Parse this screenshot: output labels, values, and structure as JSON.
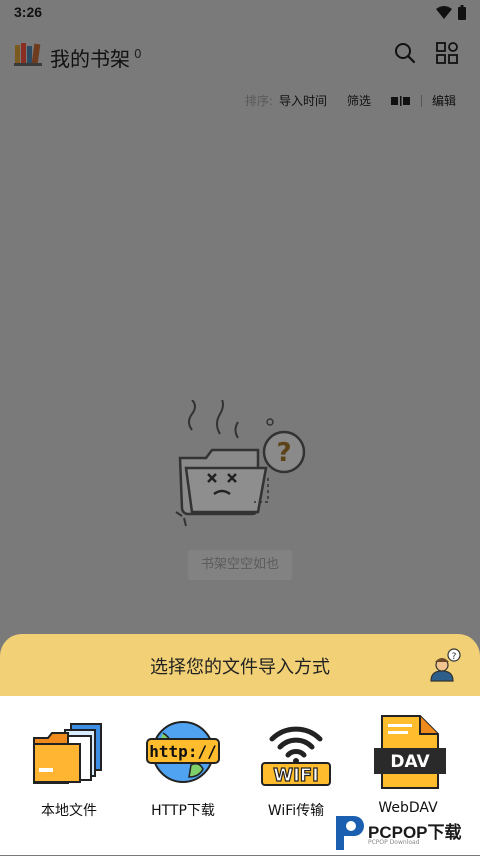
{
  "status": {
    "time": "3:26"
  },
  "header": {
    "title": "我的书架",
    "count": "0"
  },
  "sort": {
    "label": "排序:",
    "order": "导入时间",
    "filter": "筛选",
    "edit": "编辑"
  },
  "empty": {
    "text": "书架空空如也"
  },
  "import": {
    "title": "选择您的文件导入方式",
    "options": [
      {
        "label": "本地文件",
        "icon": "folder-files-icon"
      },
      {
        "label": "HTTP下载",
        "icon": "http-globe-icon",
        "badge": "http://"
      },
      {
        "label": "WiFi传输",
        "icon": "wifi-icon",
        "badge": "WIFI"
      },
      {
        "label": "WebDAV",
        "icon": "webdav-file-icon",
        "badge": "DAV"
      }
    ]
  },
  "watermark": {
    "text": "PCPOP下载",
    "sub": "PCPOP Download"
  }
}
